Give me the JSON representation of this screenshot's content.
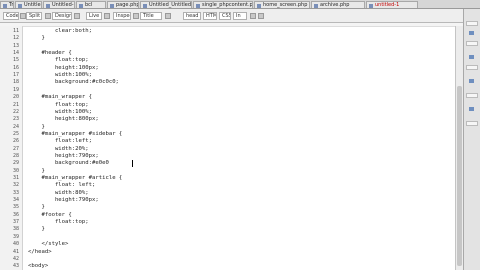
{
  "tabs": [
    {
      "label": "Tr"
    },
    {
      "label": "Untitled-2"
    },
    {
      "label": "Untitled-3"
    },
    {
      "label": "bcl"
    },
    {
      "label": "page.php"
    },
    {
      "label": "Untitled_Untitled.php"
    },
    {
      "label": "single_phpcontent.php"
    },
    {
      "label": "home_screen.php"
    },
    {
      "label": "archive.php"
    },
    {
      "label": "untitled-1"
    }
  ],
  "toolbar": {
    "items": [
      "Code",
      "Split",
      "Design",
      "Live",
      "Inspect",
      "Title",
      "head",
      "HTML",
      "CSS",
      "In"
    ]
  },
  "code_lines": [
    {
      "num": "11",
      "text": "        clear:both;"
    },
    {
      "num": "12",
      "text": "    }"
    },
    {
      "num": "13",
      "text": ""
    },
    {
      "num": "14",
      "text": "    #header {"
    },
    {
      "num": "15",
      "text": "        float:top;"
    },
    {
      "num": "16",
      "text": "        height:100px;"
    },
    {
      "num": "17",
      "text": "        width:100%;"
    },
    {
      "num": "18",
      "text": "        background:#c0c0c0;"
    },
    {
      "num": "19",
      "text": ""
    },
    {
      "num": "20",
      "text": "    #main_wrapper {"
    },
    {
      "num": "21",
      "text": "        float:top;"
    },
    {
      "num": "22",
      "text": "        width:100%;"
    },
    {
      "num": "23",
      "text": "        height:800px;"
    },
    {
      "num": "24",
      "text": "    }"
    },
    {
      "num": "25",
      "text": "    #main_wrapper #sidebar {"
    },
    {
      "num": "26",
      "text": "        float:left;"
    },
    {
      "num": "27",
      "text": "        width:20%;"
    },
    {
      "num": "28",
      "text": "        height:790px;"
    },
    {
      "num": "29",
      "text": "        background:#e0e0"
    },
    {
      "num": "30",
      "text": "    }"
    },
    {
      "num": "31",
      "text": "    #main_wrapper #article {"
    },
    {
      "num": "32",
      "text": "        float: left;"
    },
    {
      "num": "33",
      "text": "        width:80%;"
    },
    {
      "num": "34",
      "text": "        height:790px;"
    },
    {
      "num": "35",
      "text": "    }"
    },
    {
      "num": "36",
      "text": "    #footer {"
    },
    {
      "num": "37",
      "text": "        float:top;"
    },
    {
      "num": "38",
      "text": "    }"
    },
    {
      "num": "39",
      "text": ""
    },
    {
      "num": "40",
      "text": "    </style>"
    },
    {
      "num": "41",
      "text": "</head>"
    },
    {
      "num": "42",
      "text": ""
    },
    {
      "num": "43",
      "text": "<body>"
    }
  ]
}
